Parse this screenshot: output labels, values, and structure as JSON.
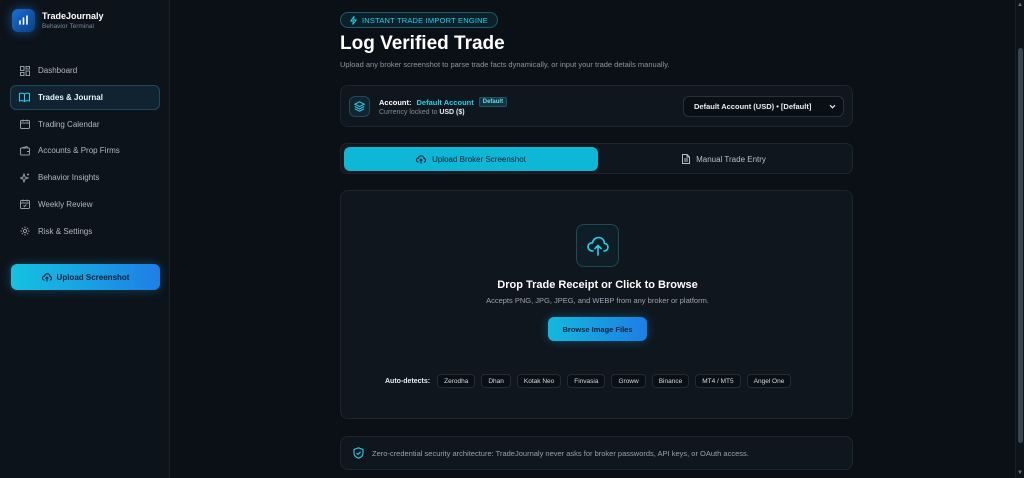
{
  "brand": {
    "name": "TradeJournaly",
    "subtitle": "Behavior Terminal"
  },
  "sidebar": {
    "items": [
      {
        "label": "Dashboard",
        "icon": "dashboard-icon"
      },
      {
        "label": "Trades & Journal",
        "icon": "book-icon",
        "active": true
      },
      {
        "label": "Trading Calendar",
        "icon": "calendar-icon"
      },
      {
        "label": "Accounts & Prop Firms",
        "icon": "wallet-icon"
      },
      {
        "label": "Behavior Insights",
        "icon": "sparkle-icon"
      },
      {
        "label": "Weekly Review",
        "icon": "calendar-check-icon"
      },
      {
        "label": "Risk & Settings",
        "icon": "gear-icon"
      }
    ],
    "upload_label": "Upload Screenshot"
  },
  "main": {
    "pill": "INSTANT TRADE IMPORT ENGINE",
    "title": "Log Verified Trade",
    "subtitle": "Upload any broker screenshot to parse trade facts dynamically, or input your trade details manually.",
    "account": {
      "label": "Account:",
      "value": "Default Account",
      "badge": "Default",
      "currency_prefix": "Currency locked to",
      "currency_value": "USD ($)",
      "select_value": "Default Account (USD) • [Default]"
    },
    "tabs": [
      {
        "label": "Upload Broker Screenshot",
        "active": true
      },
      {
        "label": "Manual Trade Entry",
        "active": false
      }
    ],
    "dropzone": {
      "title": "Drop Trade Receipt or Click to Browse",
      "subtitle": "Accepts PNG, JPG, JPEG, and WEBP from any broker or platform.",
      "browse_label": "Browse Image Files",
      "detect_label": "Auto-detects:",
      "brokers": [
        "Zerodha",
        "Dhan",
        "Kotak Neo",
        "Finvasia",
        "Groww",
        "Binance",
        "MT4 / MT5",
        "Angel One"
      ]
    },
    "security_text": "Zero-credential security architecture: TradeJournaly never asks for broker passwords, API keys, or OAuth access."
  },
  "colors": {
    "accent": "#22d3ee",
    "accent_btn": "#14c2e0",
    "bg": "#0b1016",
    "card": "#0f161e"
  }
}
